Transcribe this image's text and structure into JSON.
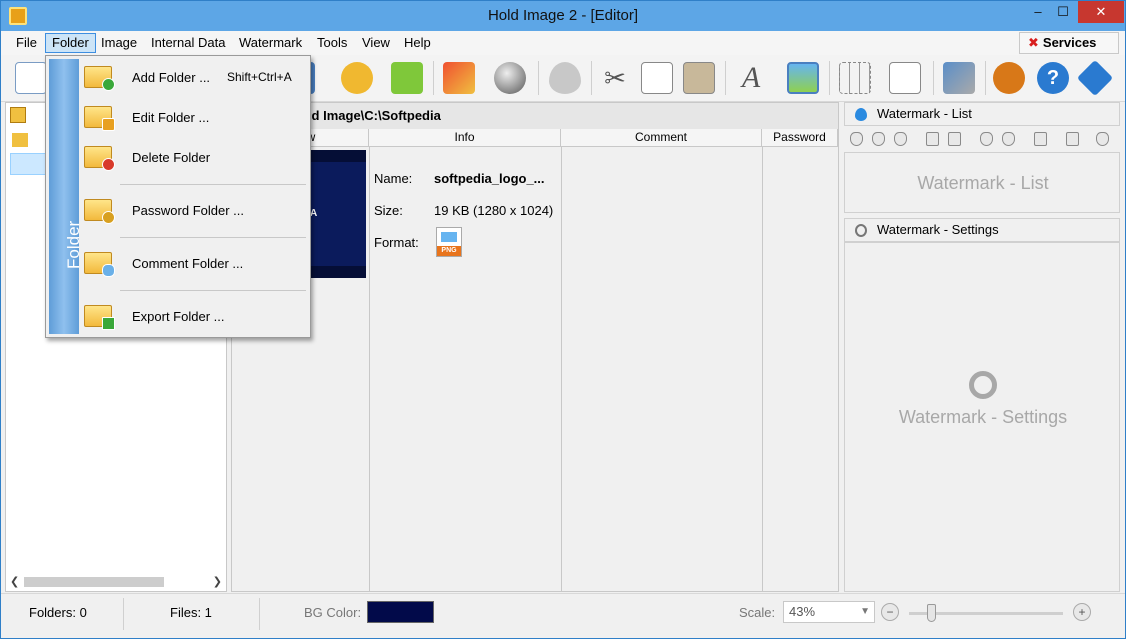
{
  "window": {
    "title": "Hold Image 2 - [Editor]"
  },
  "menubar": {
    "items": [
      "File",
      "Folder",
      "Image",
      "Internal Data",
      "Watermark",
      "Tools",
      "View",
      "Help"
    ],
    "services_label": "Services"
  },
  "folder_menu": {
    "side_title": "Folder",
    "items": [
      {
        "label": "Add Folder ...",
        "shortcut": "Shift+Ctrl+A"
      },
      {
        "label": "Edit Folder ..."
      },
      {
        "label": "Delete Folder"
      },
      {
        "label": "Password Folder ..."
      },
      {
        "label": "Comment Folder ..."
      },
      {
        "label": "Export Folder ..."
      }
    ]
  },
  "center": {
    "path": "old Image\\C:\\Softpedia",
    "columns": [
      "ew",
      "Info",
      "Comment",
      "Password"
    ],
    "preview_text": "DIA",
    "name_label": "Name:",
    "name_value": "softpedia_logo_...",
    "size_label": "Size:",
    "size_value": "19 KB (1280 x 1024)",
    "format_label": "Format:",
    "format_badge": "PNG"
  },
  "right": {
    "list_title": "Watermark - List",
    "list_placeholder": "Watermark - List",
    "settings_title": "Watermark - Settings",
    "settings_placeholder": "Watermark - Settings"
  },
  "statusbar": {
    "folders": "Folders: 0",
    "files": "Files: 1",
    "bg_color_label": "BG Color:",
    "bg_color": "#020a4a",
    "scale_label": "Scale:",
    "scale_value": "43%"
  },
  "icons": [
    "new-file-icon",
    "folder-icon",
    "image-icon",
    "badge-icon",
    "cube-icon",
    "add-image-icon",
    "sphere-icon",
    "drop-add-icon",
    "scissors-icon",
    "copy-icon",
    "paste-icon",
    "text-a-icon",
    "picture-icon",
    "grid-icon",
    "keyboard-icon",
    "tools-icon",
    "bug-icon",
    "help-icon",
    "info-icon"
  ]
}
